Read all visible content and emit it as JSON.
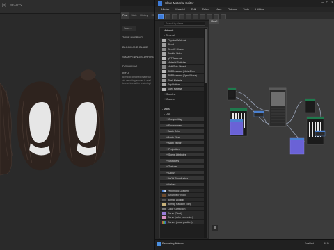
{
  "viewport": {
    "labels": [
      "[P]",
      "BEAUTY"
    ]
  },
  "render_settings": {
    "tabs": [
      "Post",
      "Stats",
      "History",
      "ER"
    ],
    "save_button": "Save...",
    "sections": [
      "TONE MAPPING",
      "BLOOM AND GLARE",
      "SHARPENING/BLURRING",
      "DENOISING",
      "INFO"
    ],
    "info_text": [
      "Blending denoised image wit",
      "via denoising amount is avail",
      "to over interactive rendering i"
    ]
  },
  "window": {
    "title": "Slate Material Editor"
  },
  "menu": [
    "Modes",
    "Material",
    "Edit",
    "Select",
    "View",
    "Options",
    "Tools",
    "Utilities"
  ],
  "search": {
    "placeholder": "Search by Name ..."
  },
  "browser": {
    "materials_header": "- Materials",
    "general_header": "- General",
    "materials": [
      "Physical Material",
      "Blend",
      "DirectX Shader",
      "Double Sided",
      "glTF Material",
      "Material Switcher",
      "Multi/Sub-Object",
      "PBR Material (Metal/Rou...",
      "PBR Material (Spec/Gloss)",
      "Shell Material",
      "Top/Bottom",
      "Shell Material"
    ],
    "scanline_header": "+ Scanline",
    "corona_header": "+ Corona",
    "maps_header": "- Maps",
    "osl_header": "- OSL",
    "map_categories": [
      "+ Compositing",
      "+ Environment",
      "+ Math Color",
      "+ Math Float",
      "+ Math Vector",
      "+ Projection",
      "+ Scene Attributes",
      "+ Switchers",
      "+ Textures",
      "+ Utility",
      "+ UVW Coordinates",
      "+ Values"
    ],
    "maps": [
      "Hyperbolic Gradient",
      "Advanced Wood",
      "Bitmap Lookup",
      "Bitmap Random Tiling",
      "Color Correction",
      "Curve (Float)",
      "Curve (color correction)",
      "Curves (color gradient)"
    ]
  },
  "view": {
    "tab_label": "View1"
  },
  "status": {
    "message": "Rendering finished",
    "enabled_label": "Enabled",
    "zoom": "61%"
  },
  "colors": {
    "accent": "#3d7bd9",
    "node_green": "#1f7a4d",
    "node_purple": "#6a62d6",
    "node_header_blue": "#4a80d0"
  }
}
